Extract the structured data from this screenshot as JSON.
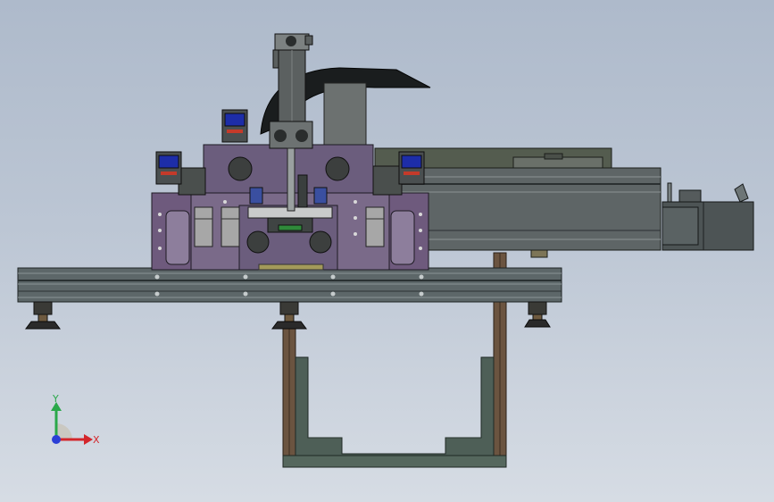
{
  "viewport": {
    "background_top": "#aebacb",
    "background_bottom": "#d6dce4"
  },
  "triad": {
    "x_label": "X",
    "y_label": "Y",
    "x_color": "#d3262b",
    "y_color": "#2aa84a",
    "z_color": "#2b3fd6"
  },
  "model": {
    "frame_color": "#5f6a6c",
    "plate_color": "#6c5a7c",
    "upright_color": "#5f4a3a",
    "channel_color": "#4f6258"
  }
}
